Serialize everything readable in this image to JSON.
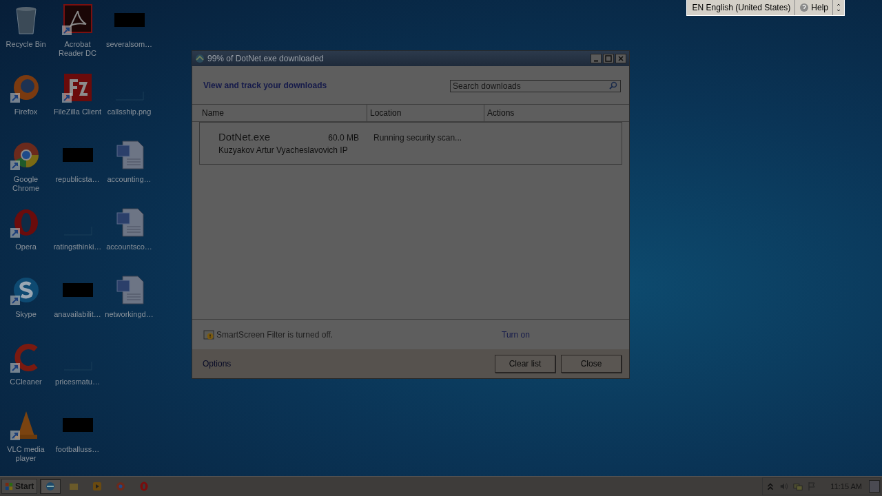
{
  "desktop_icons": [
    {
      "label": "Recycle Bin",
      "kind": "recycle"
    },
    {
      "label": "Firefox",
      "kind": "firefox"
    },
    {
      "label": "Google Chrome",
      "kind": "chrome"
    },
    {
      "label": "Opera",
      "kind": "opera"
    },
    {
      "label": "Skype",
      "kind": "skype"
    },
    {
      "label": "CCleaner",
      "kind": "ccleaner"
    },
    {
      "label": "VLC media player",
      "kind": "vlc"
    },
    {
      "label": "Acrobat Reader DC",
      "kind": "pdf"
    },
    {
      "label": "FileZilla Client",
      "kind": "filezilla"
    },
    {
      "label": "republicsta…",
      "kind": "thumb"
    },
    {
      "label": "ratingsthinki…",
      "kind": "blank"
    },
    {
      "label": "anavailabilit…",
      "kind": "thumb"
    },
    {
      "label": "pricesmatu…",
      "kind": "blank"
    },
    {
      "label": "footballuss…",
      "kind": "thumb"
    },
    {
      "label": "severalsom…",
      "kind": "thumb"
    },
    {
      "label": "callsship.png",
      "kind": "blank"
    },
    {
      "label": "accounting…",
      "kind": "word"
    },
    {
      "label": "accountsco…",
      "kind": "word"
    },
    {
      "label": "networkingd…",
      "kind": "word"
    }
  ],
  "language_bar": {
    "language": "EN English (United States)",
    "help": "Help"
  },
  "dialog": {
    "title": "99% of DotNet.exe downloaded",
    "heading": "View and track your downloads",
    "search": {
      "placeholder": "Search downloads"
    },
    "columns": [
      "Name",
      "Location",
      "Actions"
    ],
    "downloads": [
      {
        "name": "DotNet.exe",
        "size": "60.0 MB",
        "publisher": "Kuzyakov Artur Vyacheslavovich IP",
        "status": "Running security scan..."
      }
    ],
    "smartscreen": {
      "message": "SmartScreen Filter is turned off.",
      "link": "Turn on"
    },
    "options": "Options",
    "buttons": [
      "Clear list",
      "Close"
    ]
  },
  "taskbar": {
    "start": "Start",
    "apps": [
      {
        "kind": "ie",
        "selected": true
      },
      {
        "kind": "folder",
        "selected": false
      },
      {
        "kind": "media",
        "selected": false
      },
      {
        "kind": "chrome",
        "selected": false
      },
      {
        "kind": "opera",
        "selected": false
      }
    ],
    "clock": "11:15 AM"
  }
}
